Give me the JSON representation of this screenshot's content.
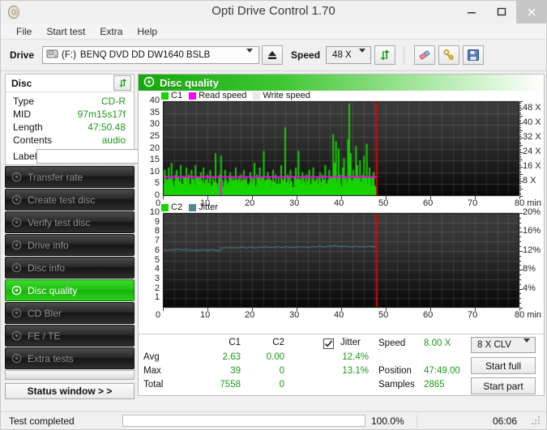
{
  "window": {
    "title": "Opti Drive Control 1.70",
    "icon": "disc-icon",
    "minimize": "–",
    "maximize": "□",
    "close": "✕"
  },
  "menubar": {
    "items": [
      "File",
      "Start test",
      "Extra",
      "Help"
    ]
  },
  "toolbar": {
    "drive_label": "Drive",
    "drive_letter": "(F:)",
    "drive_name": "BENQ DVD DD DW1640 BSLB",
    "eject_icon": "eject-icon",
    "speed_label": "Speed",
    "speed_value": "48 X",
    "refresh_icon": "refresh-icon",
    "eraser_icon": "eraser-icon",
    "tools_icon": "tools-icon",
    "save_icon": "save-icon"
  },
  "disc_panel": {
    "title": "Disc",
    "refresh_icon": "refresh-icon",
    "rows": [
      {
        "key": "Type",
        "value": "CD-R"
      },
      {
        "key": "MID",
        "value": "97m15s17f"
      },
      {
        "key": "Length",
        "value": "47:50.48"
      },
      {
        "key": "Contents",
        "value": "audio"
      }
    ],
    "label_key": "Label",
    "label_value": "",
    "label_placeholder": "",
    "cd_icon": "cd-icon"
  },
  "nav": {
    "items": [
      {
        "label": "Transfer rate",
        "icon": "disc-icon",
        "active": false
      },
      {
        "label": "Create test disc",
        "icon": "disc-icon",
        "active": false
      },
      {
        "label": "Verify test disc",
        "icon": "disc-icon",
        "active": false
      },
      {
        "label": "Drive info",
        "icon": "disc-icon",
        "active": false
      },
      {
        "label": "Disc info",
        "icon": "disc-icon",
        "active": false
      },
      {
        "label": "Disc quality",
        "icon": "disc-icon",
        "active": true
      },
      {
        "label": "CD Bler",
        "icon": "disc-icon",
        "active": false
      },
      {
        "label": "FE / TE",
        "icon": "disc-icon",
        "active": false
      },
      {
        "label": "Extra tests",
        "icon": "disc-icon",
        "active": false
      }
    ],
    "status_window_button": "Status window > >"
  },
  "main": {
    "header_title": "Disc quality",
    "header_icon": "disc-icon"
  },
  "stats": {
    "col_headers": [
      "C1",
      "C2"
    ],
    "row_labels": [
      "Avg",
      "Max",
      "Total"
    ],
    "c1": [
      "2.63",
      "39",
      "7558"
    ],
    "c2": [
      "0.00",
      "0",
      "0"
    ],
    "jitter_label": "Jitter",
    "jitter_checked": true,
    "jitter_avg": "12.4%",
    "jitter_max": "13.1%",
    "speed_label": "Speed",
    "speed_value": "8.00 X",
    "position_label": "Position",
    "position_value": "47:49.00",
    "samples_label": "Samples",
    "samples_value": "2865",
    "clv_value": "8 X CLV",
    "start_full": "Start full",
    "start_part": "Start part"
  },
  "statusbar": {
    "text": "Test completed",
    "progress_pct": 100.0,
    "progress_label": "100.0%",
    "elapsed": "06:06"
  },
  "colors": {
    "c1_green": "#18d400",
    "c2_green": "#18d400",
    "read_speed": "#ff00ff",
    "write_speed": "#e8e8e8",
    "jitter": "#4e8a90",
    "marker_red": "#e00000",
    "accent_green": "#15a80a",
    "value_green": "#1a9a1a"
  },
  "chart_data": [
    {
      "id": "c1-chart",
      "type": "line",
      "title": "Disc quality",
      "xlabel": "min",
      "ylabel": "C1",
      "xlim": [
        0,
        80
      ],
      "ylim": [
        0,
        40
      ],
      "xticks": [
        0,
        10,
        20,
        30,
        40,
        50,
        60,
        70,
        80
      ],
      "xticklabels": [
        "0",
        "10",
        "20",
        "30",
        "40",
        "50",
        "60",
        "70",
        "80 min"
      ],
      "yticks": [
        0,
        5,
        10,
        15,
        20,
        25,
        30,
        35,
        40
      ],
      "y2lim": [
        0,
        52
      ],
      "y2ticks": [
        8,
        16,
        24,
        32,
        40,
        48
      ],
      "y2ticklabels": [
        "8 X",
        "16 X",
        "24 X",
        "32 X",
        "40 X",
        "48 X"
      ],
      "grid": true,
      "legend": [
        {
          "name": "C1",
          "color": "#18d400"
        },
        {
          "name": "Read speed",
          "color": "#ff00ff"
        },
        {
          "name": "Write speed",
          "color": "#e8e8e8"
        }
      ],
      "data_end_min": 47.82,
      "marker_min": 47.82,
      "series": [
        {
          "name": "C1",
          "color": "#18d400",
          "kind": "impulse",
          "avg": 2.63,
          "max": 39,
          "total": 7558,
          "x": [
            0.0,
            0.3,
            0.6,
            0.9,
            1.2,
            1.5,
            1.8,
            2.1,
            2.4,
            2.7,
            3.0,
            3.3,
            3.6,
            3.9,
            4.2,
            4.5,
            4.8,
            5.1,
            5.4,
            5.7,
            6.0,
            6.3,
            6.6,
            6.9,
            7.2,
            7.5,
            7.8,
            8.1,
            8.4,
            8.7,
            9.0,
            9.3,
            9.6,
            9.9,
            10.2,
            10.5,
            10.8,
            11.1,
            11.4,
            11.7,
            12.0,
            12.3,
            12.6,
            12.9,
            13.2,
            13.5,
            13.8,
            14.1,
            14.4,
            14.7,
            15.0,
            15.3,
            15.6,
            15.9,
            16.2,
            16.5,
            16.8,
            17.1,
            17.4,
            17.7,
            18.0,
            18.3,
            18.6,
            18.9,
            19.2,
            19.5,
            19.8,
            20.1,
            20.4,
            20.7,
            21.0,
            21.3,
            21.6,
            21.9,
            22.2,
            22.5,
            22.8,
            23.1,
            23.4,
            23.7,
            24.0,
            24.3,
            24.6,
            24.9,
            25.2,
            25.5,
            25.8,
            26.1,
            26.4,
            26.7,
            27.0,
            27.3,
            27.6,
            27.9,
            28.2,
            28.5,
            28.8,
            29.1,
            29.4,
            29.7,
            30.0,
            30.3,
            30.6,
            30.9,
            31.2,
            31.5,
            31.8,
            32.1,
            32.4,
            32.7,
            33.0,
            33.3,
            33.6,
            33.9,
            34.2,
            34.5,
            34.8,
            35.1,
            35.4,
            35.7,
            36.0,
            36.3,
            36.6,
            36.9,
            37.2,
            37.5,
            37.8,
            38.1,
            38.4,
            38.7,
            39.0,
            39.3,
            39.6,
            39.9,
            40.2,
            40.5,
            40.8,
            41.1,
            41.4,
            41.7,
            42.0,
            42.3,
            42.6,
            42.9,
            43.2,
            43.5,
            43.8,
            44.1,
            44.4,
            44.7,
            45.0,
            45.3,
            45.6,
            45.9,
            46.2,
            46.5,
            46.8,
            47.1,
            47.4,
            47.7
          ],
          "y": [
            5,
            11,
            4,
            7,
            12,
            5,
            14,
            6,
            3,
            9,
            11,
            4,
            6,
            13,
            5,
            8,
            3,
            12,
            6,
            9,
            4,
            11,
            7,
            3,
            13,
            5,
            8,
            4,
            10,
            6,
            12,
            3,
            7,
            9,
            5,
            11,
            4,
            8,
            6,
            18,
            5,
            3,
            9,
            17,
            6,
            4,
            11,
            7,
            5,
            3,
            10,
            6,
            8,
            4,
            12,
            5,
            7,
            3,
            9,
            6,
            11,
            4,
            8,
            5,
            3,
            10,
            7,
            6,
            14,
            4,
            9,
            5,
            12,
            3,
            8,
            19,
            6,
            4,
            10,
            5,
            7,
            3,
            11,
            6,
            9,
            4,
            8,
            5,
            13,
            3,
            7,
            29,
            5,
            9,
            4,
            11,
            6,
            3,
            8,
            12,
            5,
            19,
            7,
            4,
            10,
            6,
            3,
            9,
            5,
            11,
            4,
            7,
            12,
            6,
            3,
            8,
            5,
            10,
            4,
            9,
            6,
            13,
            3,
            7,
            11,
            5,
            8,
            26,
            14,
            23,
            6,
            20,
            9,
            4,
            12,
            16,
            7,
            3,
            24,
            39,
            18,
            5,
            11,
            8,
            21,
            13,
            6,
            15,
            4,
            9,
            17,
            7,
            22,
            5,
            12,
            8,
            3,
            10
          ]
        },
        {
          "name": "Read speed",
          "color": "#ff00ff",
          "kind": "line",
          "constant_x_axis_value": 8.0,
          "x": [
            0,
            47.82
          ],
          "y": [
            8.0,
            8.0
          ]
        }
      ]
    },
    {
      "id": "c2-jitter-chart",
      "type": "line",
      "xlabel": "min",
      "ylabel": "C2",
      "xlim": [
        0,
        80
      ],
      "ylim": [
        0,
        10
      ],
      "xticks": [
        0,
        10,
        20,
        30,
        40,
        50,
        60,
        70,
        80
      ],
      "xticklabels": [
        "0",
        "10",
        "20",
        "30",
        "40",
        "50",
        "60",
        "70",
        "80 min"
      ],
      "yticks": [
        1,
        2,
        3,
        4,
        5,
        6,
        7,
        8,
        9,
        10
      ],
      "y2lim": [
        0,
        20
      ],
      "y2ticks": [
        4,
        8,
        12,
        16,
        20
      ],
      "y2ticklabels": [
        "4%",
        "8%",
        "12%",
        "16%",
        "20%"
      ],
      "grid": true,
      "legend": [
        {
          "name": "C2",
          "color": "#18d400"
        },
        {
          "name": "Jitter",
          "color": "#4e8a90"
        }
      ],
      "data_end_min": 47.82,
      "marker_min": 47.82,
      "series": [
        {
          "name": "C2",
          "color": "#18d400",
          "kind": "impulse",
          "avg": 0.0,
          "max": 0,
          "total": 0,
          "x": [],
          "y": []
        },
        {
          "name": "Jitter",
          "color": "#4e8a90",
          "kind": "line",
          "avg_pct": 12.4,
          "max_pct": 13.1,
          "x": [
            0.0,
            0.5,
            1.0,
            1.5,
            2.0,
            2.5,
            3.0,
            3.5,
            4.0,
            4.5,
            5.0,
            5.5,
            6.0,
            6.5,
            7.0,
            7.5,
            8.0,
            8.5,
            9.0,
            9.5,
            10.0,
            10.5,
            11.0,
            11.5,
            12.0,
            12.5,
            12.9,
            13.2,
            13.7,
            14.2,
            14.7,
            15.2,
            15.7,
            16.2,
            16.7,
            17.2,
            17.7,
            18.2,
            18.7,
            19.2,
            19.7,
            20.2,
            20.7,
            21.2,
            21.7,
            22.2,
            22.7,
            23.2,
            23.7,
            24.2,
            24.7,
            25.2,
            25.7,
            26.2,
            26.7,
            27.2,
            27.7,
            28.2,
            28.7,
            29.2,
            29.7,
            30.2,
            30.7,
            31.2,
            31.7,
            32.2,
            32.7,
            33.2,
            33.7,
            34.2,
            34.7,
            35.2,
            35.7,
            36.2,
            36.7,
            37.2,
            37.7,
            38.2,
            38.7,
            39.2,
            39.7,
            40.2,
            40.7,
            41.2,
            41.7,
            42.2,
            42.7,
            43.2,
            43.7,
            44.2,
            44.7,
            45.2,
            45.7,
            46.2,
            46.7,
            47.2,
            47.7
          ],
          "y_pct": [
            12.3,
            12.2,
            12.1,
            12.2,
            12.3,
            12.2,
            12.3,
            12.4,
            12.3,
            12.2,
            12.3,
            12.3,
            12.2,
            12.1,
            12.2,
            12.2,
            12.1,
            12.2,
            12.3,
            12.2,
            12.1,
            12.2,
            12.3,
            12.2,
            12.1,
            12.2,
            12.1,
            12.7,
            12.6,
            12.7,
            12.6,
            12.7,
            12.6,
            12.7,
            12.6,
            12.7,
            12.8,
            12.7,
            12.6,
            12.7,
            12.8,
            12.7,
            12.6,
            12.7,
            12.8,
            12.7,
            12.9,
            12.8,
            12.7,
            12.8,
            12.7,
            12.8,
            12.9,
            12.8,
            12.7,
            12.8,
            12.9,
            12.8,
            12.7,
            12.8,
            12.7,
            12.8,
            12.9,
            12.8,
            12.9,
            12.8,
            12.7,
            12.8,
            12.9,
            12.8,
            12.9,
            13.0,
            12.9,
            12.8,
            12.9,
            13.0,
            12.9,
            13.0,
            13.1,
            13.0,
            12.9,
            13.0,
            12.9,
            13.0,
            12.9,
            12.8,
            12.9,
            13.0,
            12.9,
            12.8,
            12.9,
            12.8,
            12.9,
            13.0,
            12.9,
            12.8,
            12.9
          ]
        }
      ]
    }
  ]
}
